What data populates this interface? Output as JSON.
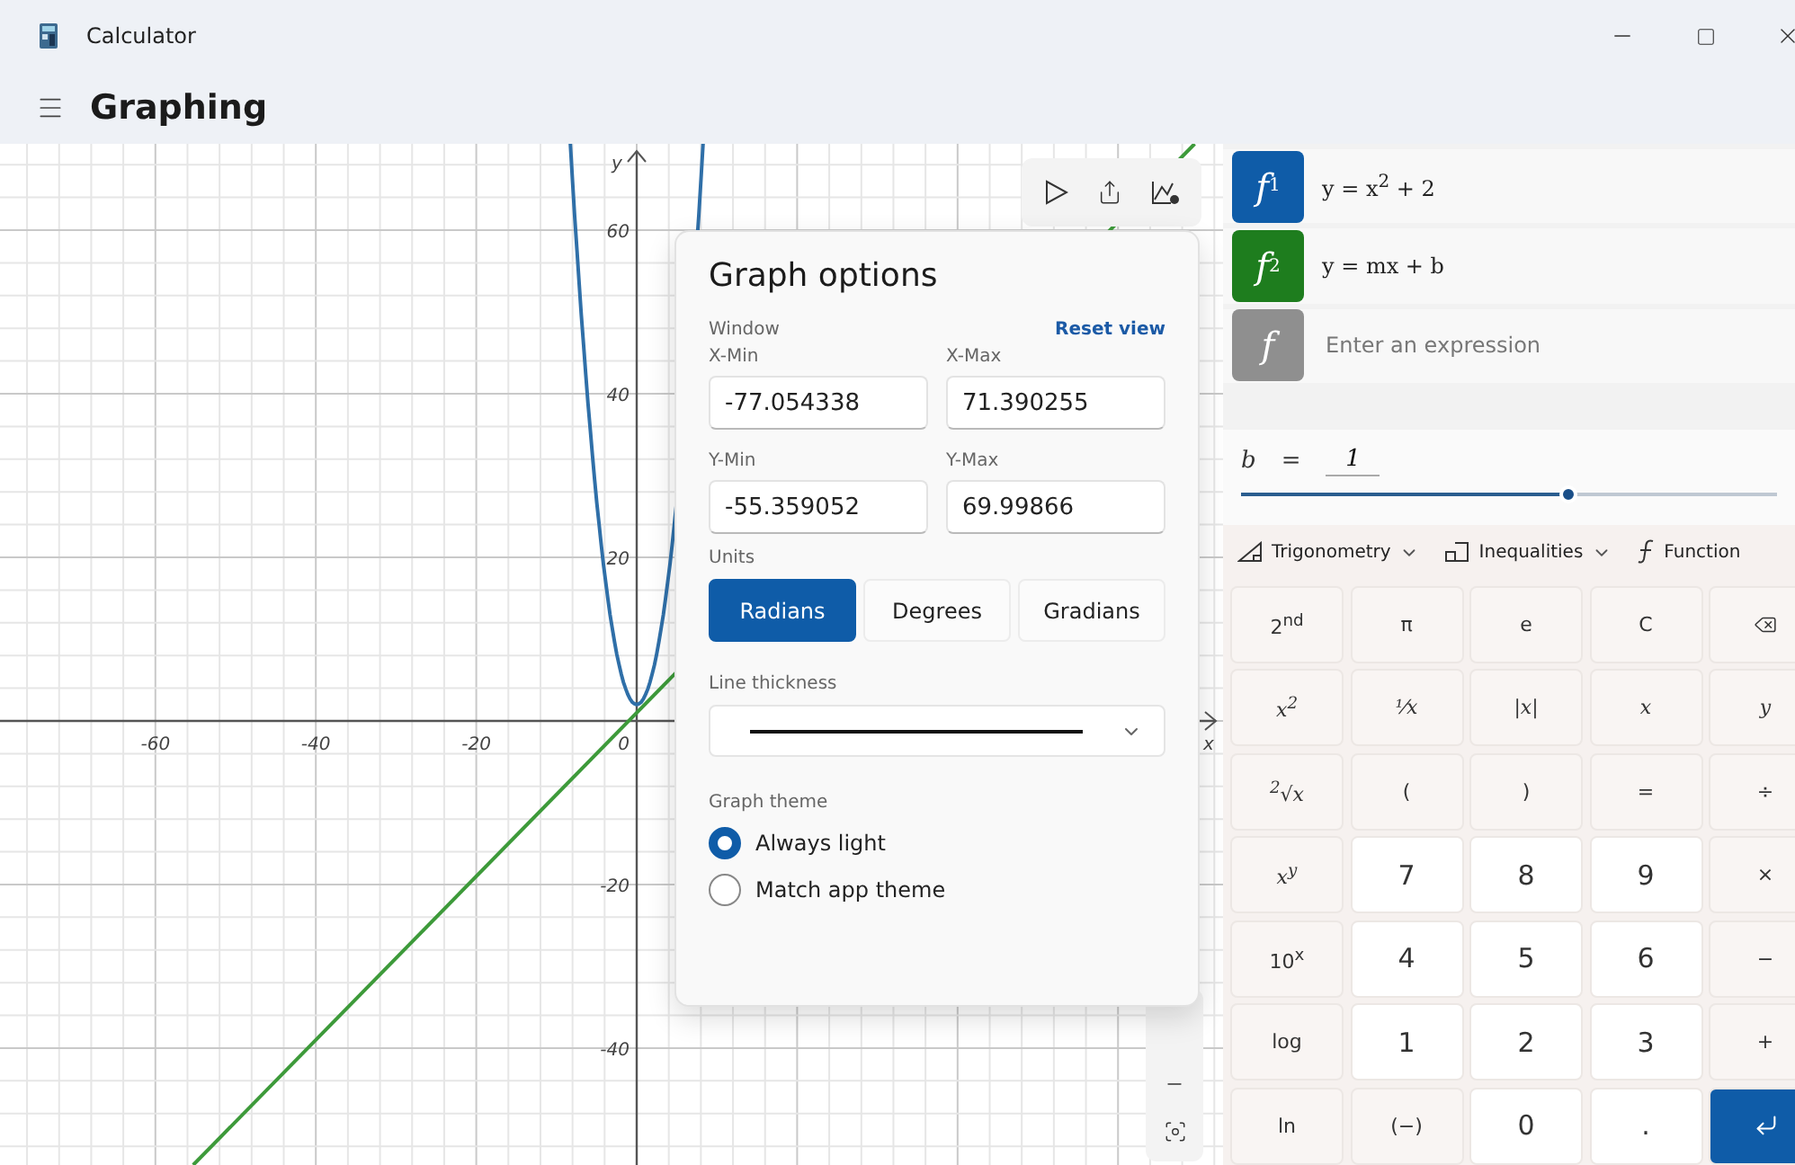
{
  "window": {
    "title": "Calculator"
  },
  "header": {
    "title": "Graphing"
  },
  "graph": {
    "x_label": "x",
    "y_label": "y",
    "x_ticks": [
      "-60",
      "-40",
      "-20",
      "0"
    ],
    "y_ticks": [
      "60",
      "40",
      "20",
      "-20",
      "-40"
    ]
  },
  "graph_options": {
    "title": "Graph options",
    "window_label": "Window",
    "reset_link": "Reset view",
    "fields": [
      {
        "label": "X-Min",
        "value": "-77.054338"
      },
      {
        "label": "X-Max",
        "value": "71.390255"
      },
      {
        "label": "Y-Min",
        "value": "-55.359052"
      },
      {
        "label": "Y-Max",
        "value": "69.99866"
      }
    ],
    "units_label": "Units",
    "units": [
      {
        "label": "Radians",
        "selected": true
      },
      {
        "label": "Degrees",
        "selected": false
      },
      {
        "label": "Gradians",
        "selected": false
      }
    ],
    "line_thickness_label": "Line thickness",
    "theme_label": "Graph theme",
    "themes": [
      {
        "label": "Always light",
        "selected": true
      },
      {
        "label": "Match app theme",
        "selected": false
      }
    ]
  },
  "functions": [
    {
      "label": "f",
      "index": "1",
      "color": "#0f5ca8",
      "expression": "y = x$^{2}$ + 2"
    },
    {
      "label": "f",
      "index": "2",
      "color": "#1e7d1e",
      "expression": "y = mx + b"
    },
    {
      "label": "f",
      "color": "#8f8f8f",
      "placeholder": "Enter an expression"
    }
  ],
  "variable": {
    "name": "b",
    "equals": "=",
    "value": "1",
    "level": 0.61
  },
  "keypad_toolbar": [
    {
      "label": "Trigonometry",
      "kind": "trig",
      "dropdown": true
    },
    {
      "label": "Inequalities",
      "kind": "ineq",
      "dropdown": true
    },
    {
      "label": "Function",
      "kind": "func",
      "dropdown": false
    }
  ],
  "keys": [
    {
      "label": "2$^{nd}$",
      "kind": "op"
    },
    {
      "label": "π",
      "kind": "op"
    },
    {
      "label": "e",
      "kind": "op"
    },
    {
      "label": "C",
      "kind": "op"
    },
    {
      "kind": "backspace"
    },
    {
      "label": "x$^{2}$",
      "kind": "math"
    },
    {
      "label": "⅟x",
      "kind": "math"
    },
    {
      "label": "|x|",
      "kind": "math"
    },
    {
      "label": "x",
      "kind": "math"
    },
    {
      "label": "y",
      "kind": "math"
    },
    {
      "label": "$^{2}$√x",
      "kind": "math"
    },
    {
      "label": "(",
      "kind": "op"
    },
    {
      "label": ")",
      "kind": "op"
    },
    {
      "label": "=",
      "kind": "op"
    },
    {
      "label": "÷",
      "kind": "op"
    },
    {
      "label": "x$^{y}$",
      "kind": "math"
    },
    {
      "label": "7",
      "kind": "num"
    },
    {
      "label": "8",
      "kind": "num"
    },
    {
      "label": "9",
      "kind": "num"
    },
    {
      "label": "×",
      "kind": "op"
    },
    {
      "label": "10$^{x}$",
      "kind": "op"
    },
    {
      "label": "4",
      "kind": "num"
    },
    {
      "label": "5",
      "kind": "num"
    },
    {
      "label": "6",
      "kind": "num"
    },
    {
      "label": "−",
      "kind": "op"
    },
    {
      "label": "log",
      "kind": "op"
    },
    {
      "label": "1",
      "kind": "num"
    },
    {
      "label": "2",
      "kind": "num"
    },
    {
      "label": "3",
      "kind": "num"
    },
    {
      "label": "+",
      "kind": "op"
    },
    {
      "label": "ln",
      "kind": "op"
    },
    {
      "label": "(−)",
      "kind": "op"
    },
    {
      "label": "0",
      "kind": "num"
    },
    {
      "label": ".",
      "kind": "num"
    },
    {
      "kind": "enter"
    }
  ]
}
